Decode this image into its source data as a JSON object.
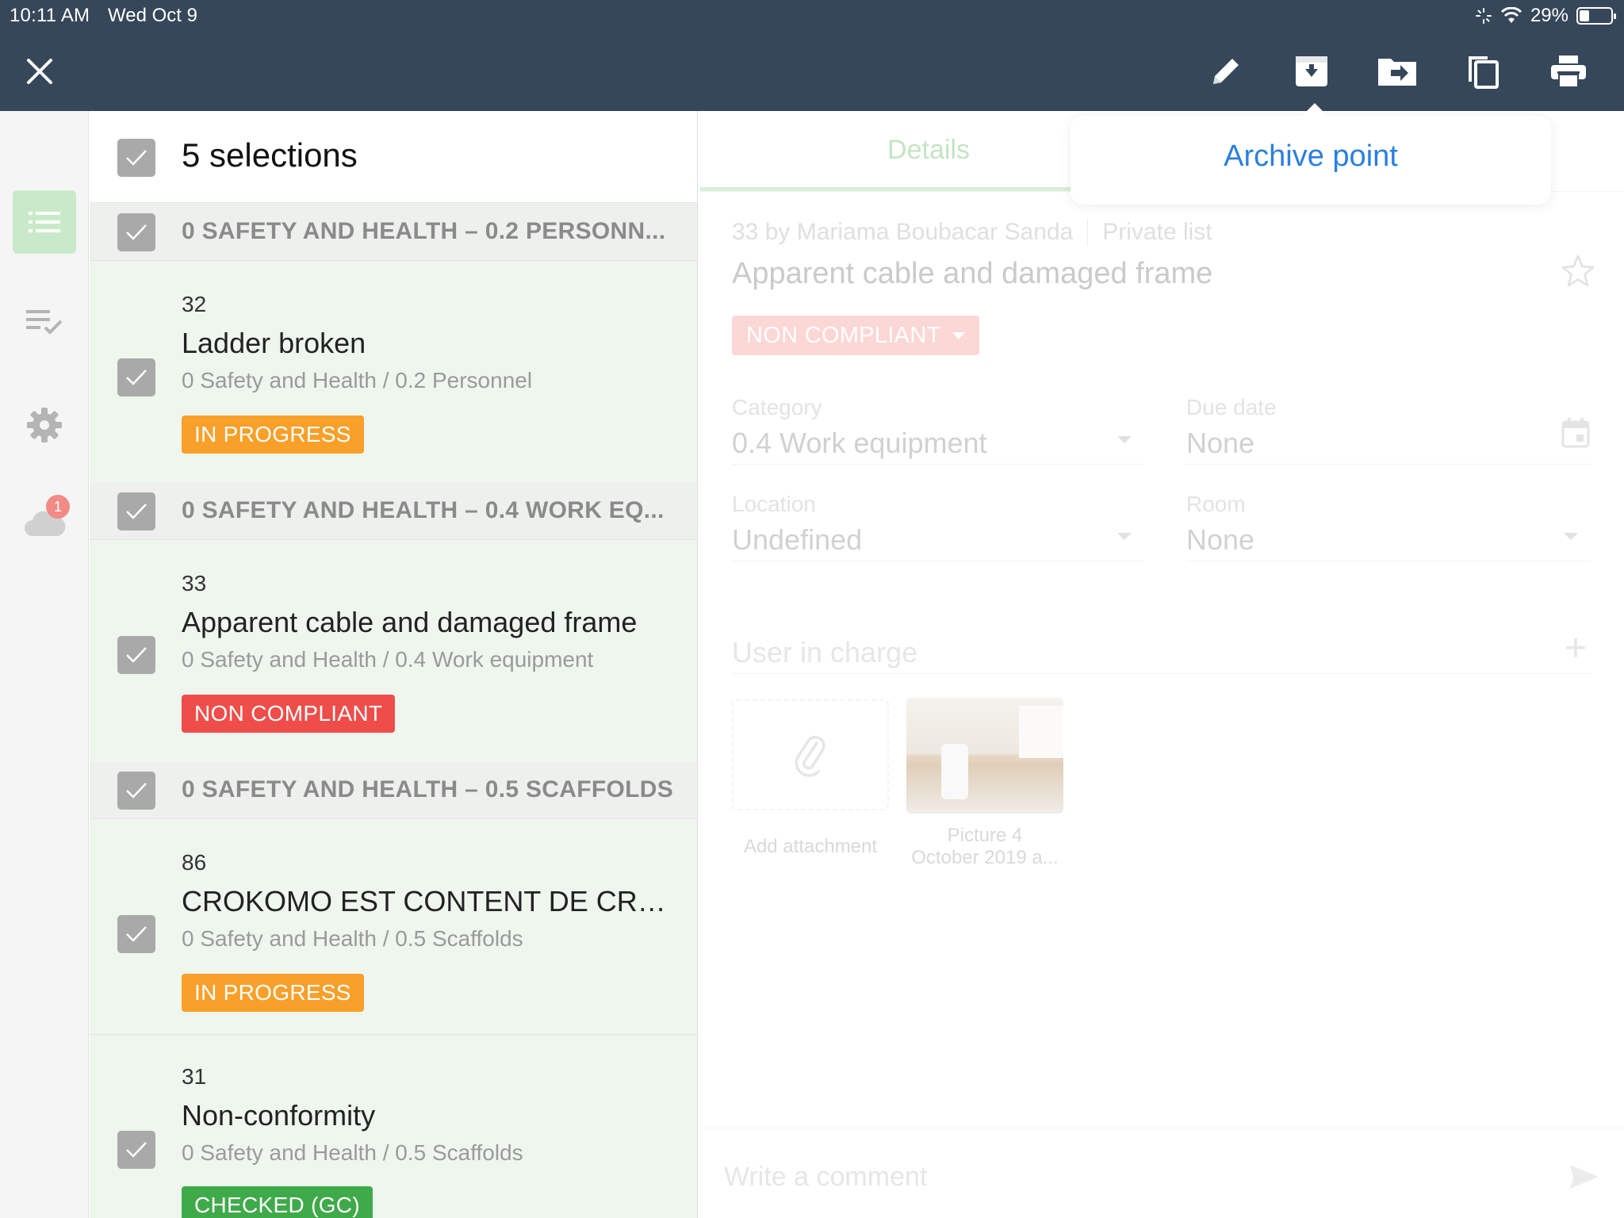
{
  "status_bar": {
    "time": "10:11 AM",
    "date": "Wed Oct 9",
    "battery": "29%",
    "battery_level": 0.29
  },
  "toolbar": {
    "close_icon": "close-icon",
    "actions": [
      "edit-icon",
      "archive-icon",
      "move-icon",
      "duplicate-icon",
      "print-icon"
    ]
  },
  "rail": {
    "items": [
      "list-icon",
      "checklist-icon",
      "gear-icon",
      "cloud-icon"
    ],
    "cloud_badge": "1"
  },
  "list": {
    "header_title": "5 selections",
    "groups": [
      {
        "label": "0 SAFETY AND HEALTH – 0.2 PERSONN..."
      },
      {
        "label": "0 SAFETY AND HEALTH – 0.4 WORK EQ..."
      },
      {
        "label": "0 SAFETY AND HEALTH – 0.5 SCAFFOLDS"
      }
    ],
    "items": [
      {
        "number": "32",
        "title": "Ladder broken",
        "path": "0 Safety and Health / 0.2 Personnel",
        "status": "IN PROGRESS",
        "status_color": "#f8a02a"
      },
      {
        "number": "33",
        "title": "Apparent cable and damaged frame",
        "path": "0 Safety and Health / 0.4 Work equipment",
        "status": "NON COMPLIANT",
        "status_color": "#ef4d4a"
      },
      {
        "number": "86",
        "title": "CROKOMO EST CONTENT DE CRO...",
        "path": "0 Safety and Health / 0.5 Scaffolds",
        "status": "IN PROGRESS",
        "status_color": "#f8a02a"
      },
      {
        "number": "31",
        "title": "Non-conformity",
        "path": "0 Safety and Health / 0.5 Scaffolds",
        "status": "CHECKED (GC)",
        "status_color": "#3faa4a"
      }
    ]
  },
  "detail": {
    "tab_details": "Details",
    "meta_author": "33 by Mariama Boubacar Sanda",
    "meta_list": "Private list",
    "title": "Apparent cable and damaged frame",
    "status": "NON COMPLIANT",
    "fields": {
      "category_label": "Category",
      "category_value": "0.4 Work equipment",
      "due_label": "Due date",
      "due_value": "None",
      "location_label": "Location",
      "location_value": "Undefined",
      "room_label": "Room",
      "room_value": "None"
    },
    "user_in_charge": "User in charge",
    "add_attachment": "Add attachment",
    "picture_line1": "Picture 4",
    "picture_line2": "October 2019 a...",
    "comment_placeholder": "Write a comment"
  },
  "popover": {
    "action": "Archive point"
  },
  "colors": {
    "topbar": "#36475a",
    "accent_green": "#7cc47c",
    "link_blue": "#2b7fe0"
  }
}
